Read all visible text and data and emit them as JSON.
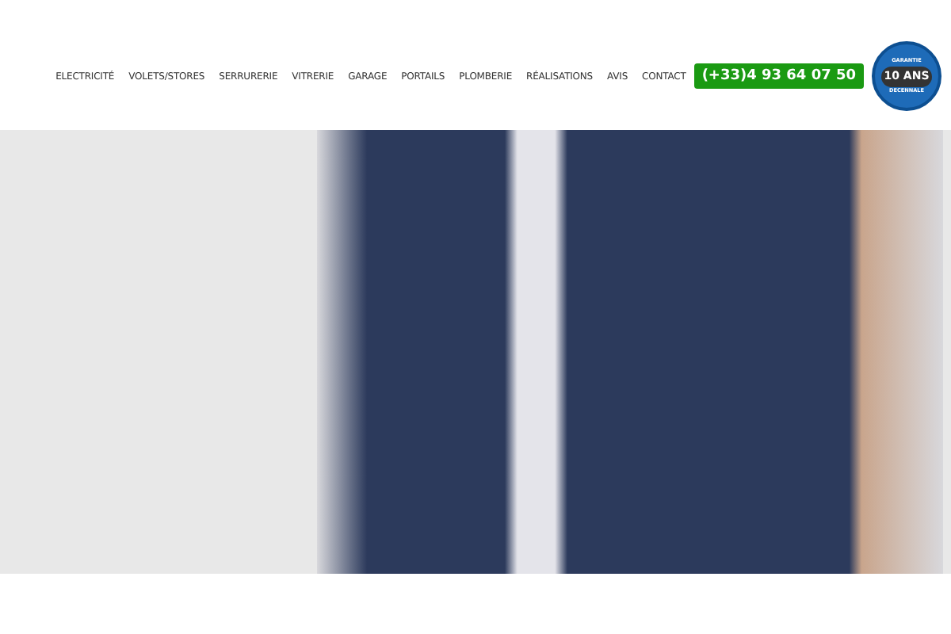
{
  "nav": {
    "items": [
      {
        "label": "ELECTRICITÉ"
      },
      {
        "label": "VOLETS/STORES"
      },
      {
        "label": "SERRURERIE"
      },
      {
        "label": "VITRERIE"
      },
      {
        "label": "GARAGE"
      },
      {
        "label": "PORTAILS"
      },
      {
        "label": "PLOMBERIE"
      },
      {
        "label": "RÉALISATIONS"
      },
      {
        "label": "AVIS"
      },
      {
        "label": "CONTACT"
      }
    ],
    "phone": "(+33)4 93 64 07 50",
    "badge": {
      "top": "GARANTIE",
      "main": "10 ANS",
      "bottom": "DECENNALE"
    }
  }
}
